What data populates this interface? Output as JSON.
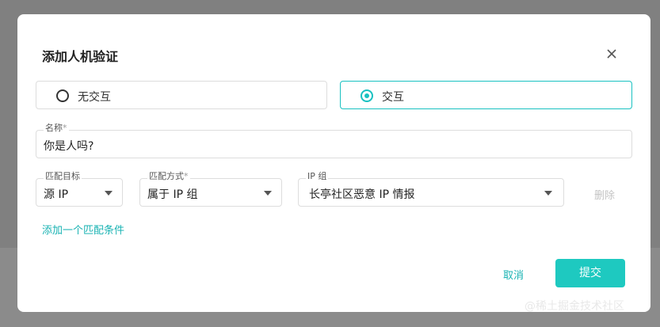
{
  "dialog": {
    "title": "添加人机验证",
    "close_icon": "close-icon"
  },
  "mode_options": [
    {
      "label": "无交互",
      "selected": false
    },
    {
      "label": "交互",
      "selected": true
    }
  ],
  "name_field": {
    "label": "名称",
    "required_mark": "*",
    "value": "你是人吗?"
  },
  "match_rule": {
    "target": {
      "label": "匹配目标",
      "value": "源 IP"
    },
    "method": {
      "label": "匹配方式",
      "required_mark": "*",
      "value": "属于 IP 组"
    },
    "ip_group": {
      "label": "IP 组",
      "value": "长亭社区恶意 IP 情报"
    },
    "delete_label": "删除"
  },
  "add_condition_label": "添加一个匹配条件",
  "footer": {
    "cancel_label": "取消",
    "submit_label": "提交"
  },
  "watermark": "@稀土掘金技术社区",
  "colors": {
    "accent": "#1ec9c0",
    "link": "#19b3b3",
    "overlay": "#808080"
  }
}
